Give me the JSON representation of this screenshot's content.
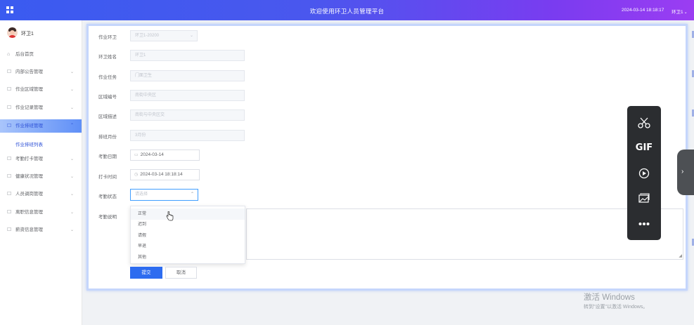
{
  "header": {
    "title": "欢迎使用环卫人员管理平台",
    "datetime": "2024-03-14 18:18:17",
    "user": "环卫1",
    "user_caret": "⌄"
  },
  "sidebar": {
    "profile_name": "环卫1",
    "items": [
      {
        "label": "后台首页",
        "icon": "home-icon"
      },
      {
        "label": "内部公告管理",
        "icon": "doc-icon"
      },
      {
        "label": "作业区域管理",
        "icon": "doc-icon"
      },
      {
        "label": "作业记录管理",
        "icon": "doc-icon"
      },
      {
        "label": "作业排班管理",
        "icon": "doc-icon",
        "active": true
      },
      {
        "label": "考勤打卡管理",
        "icon": "doc-icon"
      },
      {
        "label": "健康状况管理",
        "icon": "doc-icon"
      },
      {
        "label": "人员调岗管理",
        "icon": "doc-icon"
      },
      {
        "label": "离职信息管理",
        "icon": "doc-icon"
      },
      {
        "label": "薪资信息管理",
        "icon": "doc-icon"
      }
    ],
    "active_sub": "作业排班列表",
    "accent_color": "#5f8ff7"
  },
  "form": {
    "fields": {
      "area": {
        "label": "作业环卫",
        "value": "环卫1-20200"
      },
      "name": {
        "label": "环卫姓名",
        "value": "环卫1"
      },
      "task": {
        "label": "作业任务",
        "value": "门面卫生"
      },
      "region": {
        "label": "区域编号",
        "value": "南街中央区"
      },
      "zone": {
        "label": "区域描述",
        "value": "南街与中央区交"
      },
      "month": {
        "label": "排班月份",
        "value": "3月份"
      },
      "schedule_date": {
        "label": "考勤日期",
        "value": "2024-03-14"
      },
      "clock_time": {
        "label": "打卡时间",
        "value": "2024-03-14 18:18:14"
      },
      "status": {
        "label": "考勤状态",
        "placeholder": "请选择"
      },
      "note": {
        "label": "考勤说明"
      }
    },
    "status_options": [
      "正常",
      "迟到",
      "请假",
      "早退",
      "其他"
    ],
    "submit_label": "提交",
    "cancel_label": "取消"
  },
  "toolbar": {
    "items": [
      "scissors-icon",
      "GIF",
      "record-icon",
      "image-icon",
      "more-icon"
    ],
    "gif_label": "GIF"
  },
  "watermark": {
    "title": "激活 Windows",
    "subtitle": "转到\"设置\"以激活 Windows。"
  }
}
